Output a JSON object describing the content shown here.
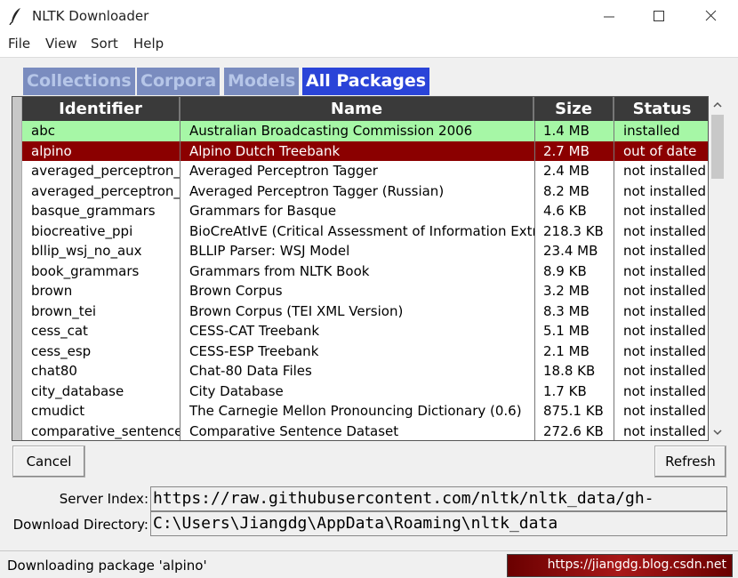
{
  "window": {
    "title": "NLTK Downloader"
  },
  "menu": [
    "File",
    "View",
    "Sort",
    "Help"
  ],
  "tabs": [
    "Collections",
    "Corpora",
    "Models",
    "All Packages"
  ],
  "active_tab": "All Packages",
  "columns": [
    "Identifier",
    "Name",
    "Size",
    "Status"
  ],
  "rows": [
    {
      "id": "abc",
      "name": "Australian Broadcasting Commission 2006",
      "size": "1.4 MB",
      "status": "installed",
      "state": "installed"
    },
    {
      "id": "alpino",
      "name": "Alpino Dutch Treebank",
      "size": "2.7 MB",
      "status": "out of date",
      "state": "outdated"
    },
    {
      "id": "averaged_perceptron_t",
      "name": "Averaged Perceptron Tagger",
      "size": "2.4 MB",
      "status": "not installed",
      "state": "none"
    },
    {
      "id": "averaged_perceptron_t",
      "name": "Averaged Perceptron Tagger (Russian)",
      "size": "8.2 MB",
      "status": "not installed",
      "state": "none"
    },
    {
      "id": "basque_grammars",
      "name": "Grammars for Basque",
      "size": "4.6 KB",
      "status": "not installed",
      "state": "none"
    },
    {
      "id": "biocreative_ppi",
      "name": "BioCreAtIvE (Critical Assessment of Information Extra",
      "size": "218.3 KB",
      "status": "not installed",
      "state": "none"
    },
    {
      "id": "bllip_wsj_no_aux",
      "name": "BLLIP Parser: WSJ Model",
      "size": "23.4 MB",
      "status": "not installed",
      "state": "none"
    },
    {
      "id": "book_grammars",
      "name": "Grammars from NLTK Book",
      "size": "8.9 KB",
      "status": "not installed",
      "state": "none"
    },
    {
      "id": "brown",
      "name": "Brown Corpus",
      "size": "3.2 MB",
      "status": "not installed",
      "state": "none"
    },
    {
      "id": "brown_tei",
      "name": "Brown Corpus (TEI XML Version)",
      "size": "8.3 MB",
      "status": "not installed",
      "state": "none"
    },
    {
      "id": "cess_cat",
      "name": "CESS-CAT Treebank",
      "size": "5.1 MB",
      "status": "not installed",
      "state": "none"
    },
    {
      "id": "cess_esp",
      "name": "CESS-ESP Treebank",
      "size": "2.1 MB",
      "status": "not installed",
      "state": "none"
    },
    {
      "id": "chat80",
      "name": "Chat-80 Data Files",
      "size": "18.8 KB",
      "status": "not installed",
      "state": "none"
    },
    {
      "id": "city_database",
      "name": "City Database",
      "size": "1.7 KB",
      "status": "not installed",
      "state": "none"
    },
    {
      "id": "cmudict",
      "name": "The Carnegie Mellon Pronouncing Dictionary (0.6)",
      "size": "875.1 KB",
      "status": "not installed",
      "state": "none"
    },
    {
      "id": "comparative_sentences",
      "name": "Comparative Sentence Dataset",
      "size": "272.6 KB",
      "status": "not installed",
      "state": "none"
    }
  ],
  "buttons": {
    "cancel": "Cancel",
    "refresh": "Refresh"
  },
  "server_index": {
    "label": "Server Index:",
    "value": "https://raw.githubusercontent.com/nltk/nltk_data/gh-"
  },
  "download_dir": {
    "label": "Download Directory:",
    "value": "C:\\Users\\Jiangdg\\AppData\\Roaming\\nltk_data"
  },
  "status": {
    "text": "Downloading package 'alpino'",
    "progress_fraction": 1.0,
    "watermark": "https://jiangdg.blog.csdn.net"
  },
  "colors": {
    "installed_row": "#a6f7a6",
    "outdated_row": "#8b0000",
    "active_tab": "#2a44d8",
    "inactive_tab": "#7a8cbf"
  },
  "icons": [
    "feather-icon",
    "minimize-icon",
    "maximize-icon",
    "close-icon",
    "scroll-up-icon",
    "scroll-down-icon"
  ]
}
